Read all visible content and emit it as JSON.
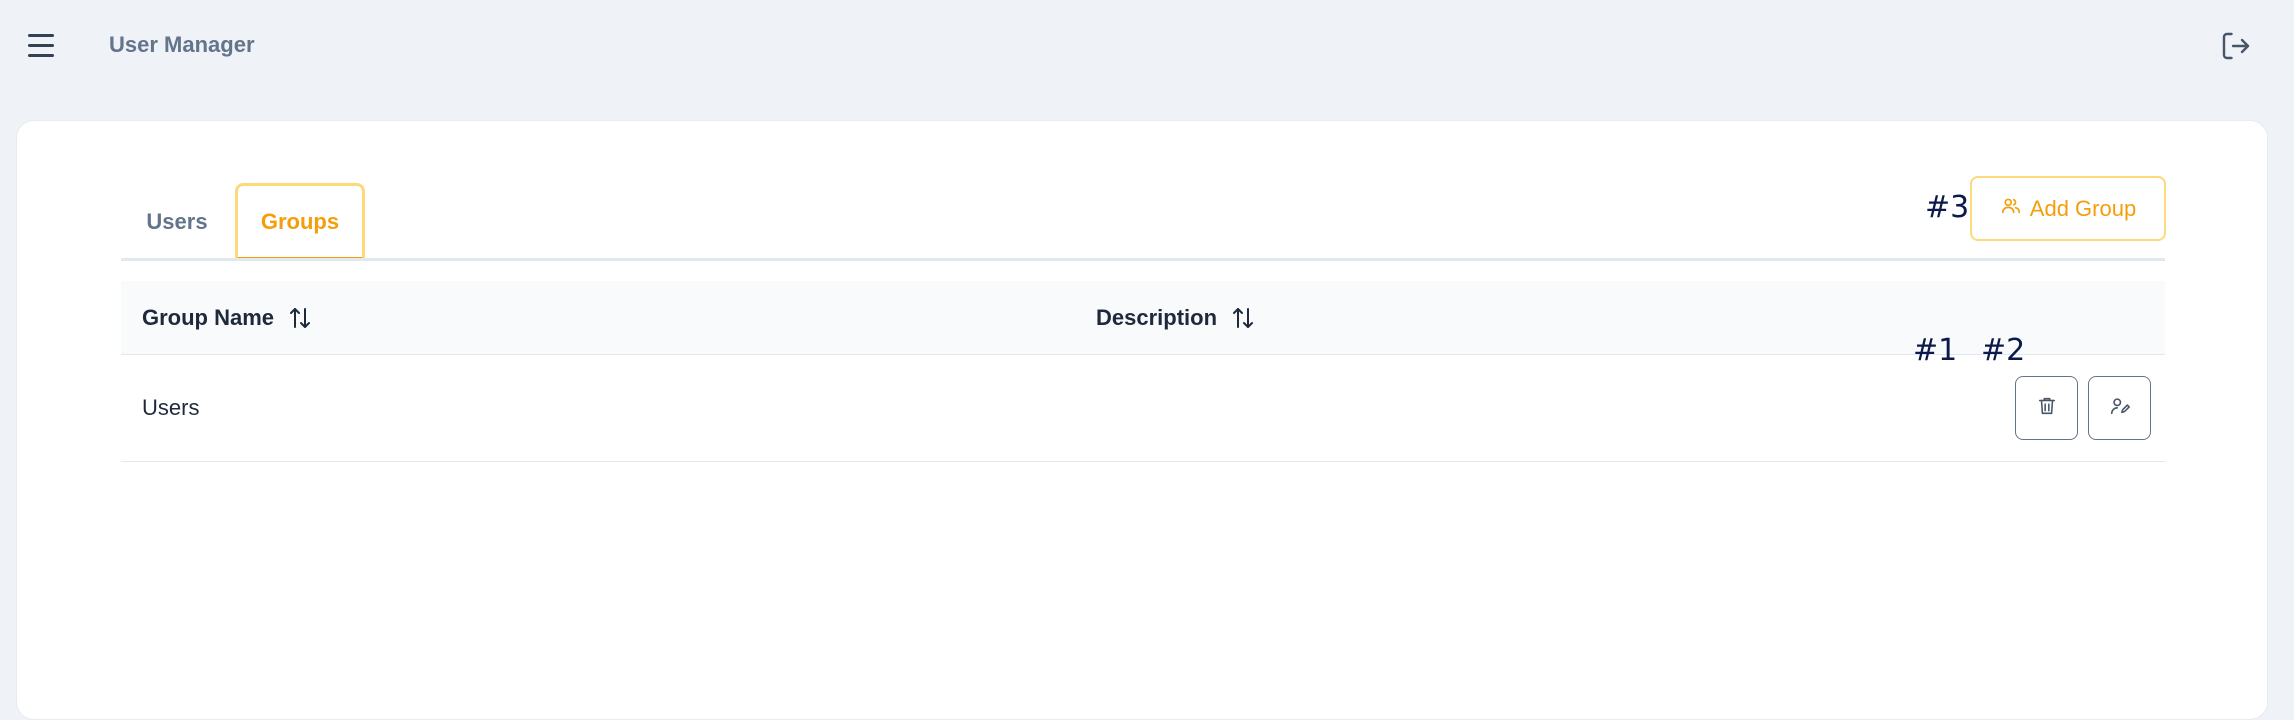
{
  "header": {
    "title": "User Manager",
    "menu_icon": "hamburger-menu-icon",
    "logout_icon": "logout-icon"
  },
  "tabs": [
    {
      "label": "Users",
      "active": false
    },
    {
      "label": "Groups",
      "active": true
    }
  ],
  "actions": {
    "add_group_label": "Add Group",
    "add_group_icon": "users-icon"
  },
  "table": {
    "columns": [
      {
        "label": "Group Name",
        "sort_icon": "sort-arrows-icon"
      },
      {
        "label": "Description",
        "sort_icon": "sort-arrows-icon"
      }
    ],
    "rows": [
      {
        "name": "Users",
        "description": ""
      }
    ],
    "row_actions": {
      "delete_icon": "trash-icon",
      "edit_icon": "user-edit-icon"
    }
  },
  "markers": {
    "delete": "#1",
    "edit": "#2",
    "add_group": "#3"
  },
  "colors": {
    "accent": "#f59e0b",
    "accent_light": "#fcd97a",
    "background": "#eff2f7",
    "marker": "#0c1a4b"
  }
}
